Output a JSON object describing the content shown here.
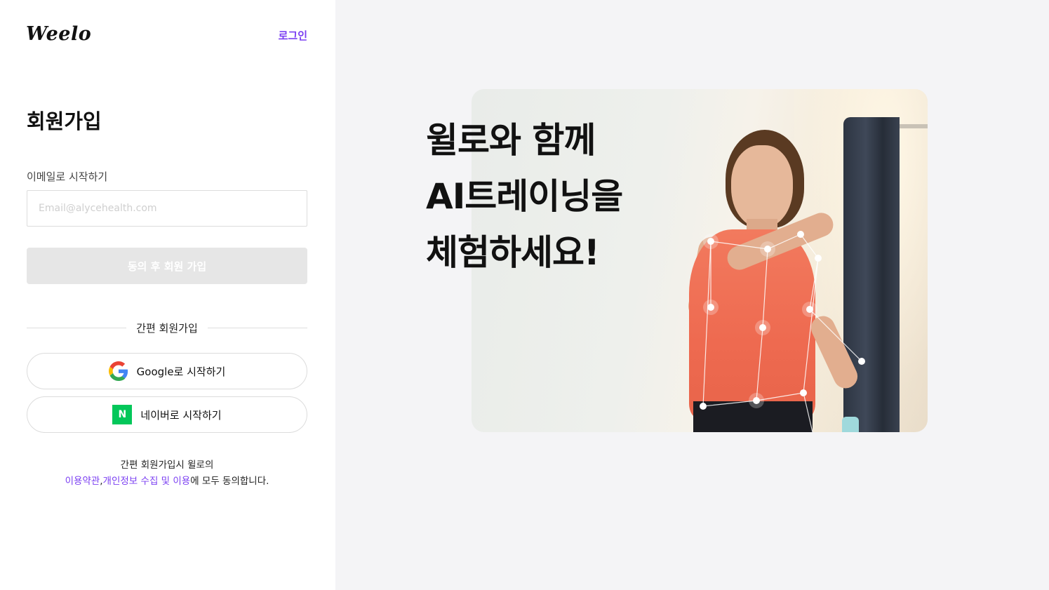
{
  "header": {
    "logo": "Weelo",
    "login_label": "로그인"
  },
  "signup": {
    "title": "회원가입",
    "email_label": "이메일로 시작하기",
    "email_placeholder": "Email@alycehealth.com",
    "email_value": "",
    "submit_label": "동의 후 회원 가입",
    "divider_label": "간편 회원가입",
    "google_label": "Google로 시작하기",
    "naver_label": "네이버로 시작하기",
    "naver_icon_text": "N",
    "terms_line1": "간편 회원가입시 윌로의",
    "terms_link1": "이용약관",
    "terms_sep": ",",
    "terms_link2": "개인정보 수집 및 이용",
    "terms_tail": "에 모두 동의합니다."
  },
  "hero": {
    "line1": "윌로와 함께",
    "line2": "AI트레이닝을",
    "line3": "체험하세요!"
  },
  "icons": {
    "google": "google-icon",
    "naver": "naver-icon"
  },
  "colors": {
    "accent": "#7b3ff2",
    "naver_green": "#03c75a",
    "disabled_button": "#e6e6e6",
    "right_background": "#f4f4f6"
  }
}
